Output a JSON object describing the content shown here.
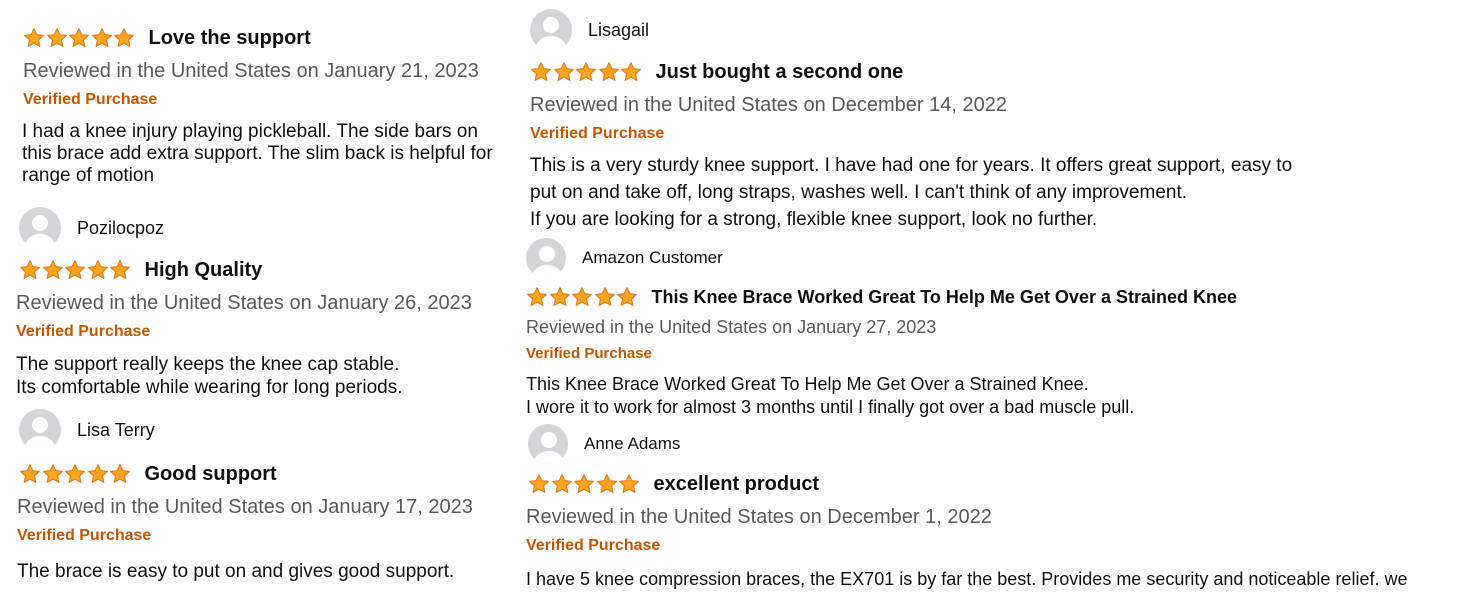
{
  "reviews_left": [
    {
      "name": "",
      "title": "Love the support",
      "meta": "Reviewed in the United States on January 21, 2023",
      "verified": "Verified Purchase",
      "lines": [
        "I had a knee injury playing pickleball. The side bars on",
        "this brace add extra support. The slim back is helpful for",
        "range of motion"
      ]
    },
    {
      "name": "Pozilocpoz",
      "title": "High Quality",
      "meta": "Reviewed in the United States on January 26, 2023",
      "verified": "Verified Purchase",
      "lines": [
        "The support really keeps the knee cap stable.",
        "Its comfortable while wearing for long periods."
      ]
    },
    {
      "name": "Lisa Terry",
      "title": "Good support",
      "meta": "Reviewed in the United States on January 17, 2023",
      "verified": "Verified Purchase",
      "lines": [
        "The brace is easy to put on and gives good support."
      ]
    }
  ],
  "reviews_right": [
    {
      "name": "Lisagail",
      "title": "Just bought a second one",
      "meta": "Reviewed in the United States on December 14, 2022",
      "verified": "Verified Purchase",
      "lines": [
        "This is a very sturdy knee support. I have had one for years. It offers great support, easy to",
        "put on and take off, long straps, washes well. I can't think of any improvement.",
        "If you are looking for a strong, flexible knee support, look no further."
      ]
    },
    {
      "name": "Amazon Customer",
      "title": "This Knee Brace Worked Great To Help Me Get Over a Strained Knee",
      "meta": "Reviewed in the United States on January 27, 2023",
      "verified": "Verified Purchase",
      "lines": [
        "This Knee Brace Worked Great To Help Me Get Over a Strained Knee.",
        "I wore it to work for almost 3 months until I finally got over a bad muscle pull."
      ]
    },
    {
      "name": "Anne Adams",
      "title": "excellent product",
      "meta": "Reviewed in the United States on December 1, 2022",
      "verified": "Verified Purchase",
      "lines": [
        "I have 5 knee compression braces, the EX701 is by far the best. Provides me security and noticeable relief.   we"
      ]
    }
  ],
  "rating": {
    "stars": 5,
    "max": 5
  },
  "colors": {
    "star_fill": "#ffa41c",
    "star_stroke": "#de7921",
    "verified": "#c45500",
    "meta": "#565959",
    "text": "#0f1111",
    "avatar": "#d3d6d9"
  },
  "icons": {
    "avatar": "default-user-avatar-icon",
    "star": "star-icon"
  }
}
